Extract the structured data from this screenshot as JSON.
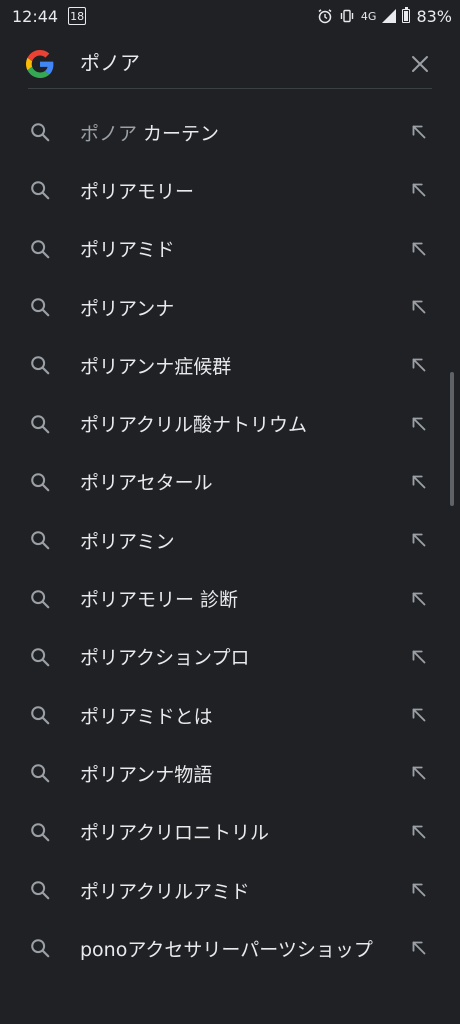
{
  "status_bar": {
    "time": "12:44",
    "notification_count": "18",
    "network": "4G",
    "battery": "83%"
  },
  "search": {
    "query": "ポノア",
    "clear_icon": "close-icon",
    "logo": "google-g-logo"
  },
  "suggestions": [
    {
      "typed": "ポノア",
      "rest": " カーテン"
    },
    {
      "typed": "",
      "rest": "ポリアモリー"
    },
    {
      "typed": "",
      "rest": "ポリアミド"
    },
    {
      "typed": "",
      "rest": "ポリアンナ"
    },
    {
      "typed": "",
      "rest": "ポリアンナ症候群"
    },
    {
      "typed": "",
      "rest": "ポリアクリル酸ナトリウム"
    },
    {
      "typed": "",
      "rest": "ポリアセタール"
    },
    {
      "typed": "",
      "rest": "ポリアミン"
    },
    {
      "typed": "",
      "rest": "ポリアモリー 診断"
    },
    {
      "typed": "",
      "rest": "ポリアクションプロ"
    },
    {
      "typed": "",
      "rest": "ポリアミドとは"
    },
    {
      "typed": "",
      "rest": "ポリアンナ物語"
    },
    {
      "typed": "",
      "rest": "ポリアクリロニトリル"
    },
    {
      "typed": "",
      "rest": "ポリアクリルアミド"
    },
    {
      "typed": "",
      "rest": "ponoアクセサリーパーツショップ"
    }
  ],
  "colors": {
    "background": "#202124",
    "text": "#e8eaed",
    "muted": "#9aa0a6",
    "icon": "#9aa0a6"
  }
}
